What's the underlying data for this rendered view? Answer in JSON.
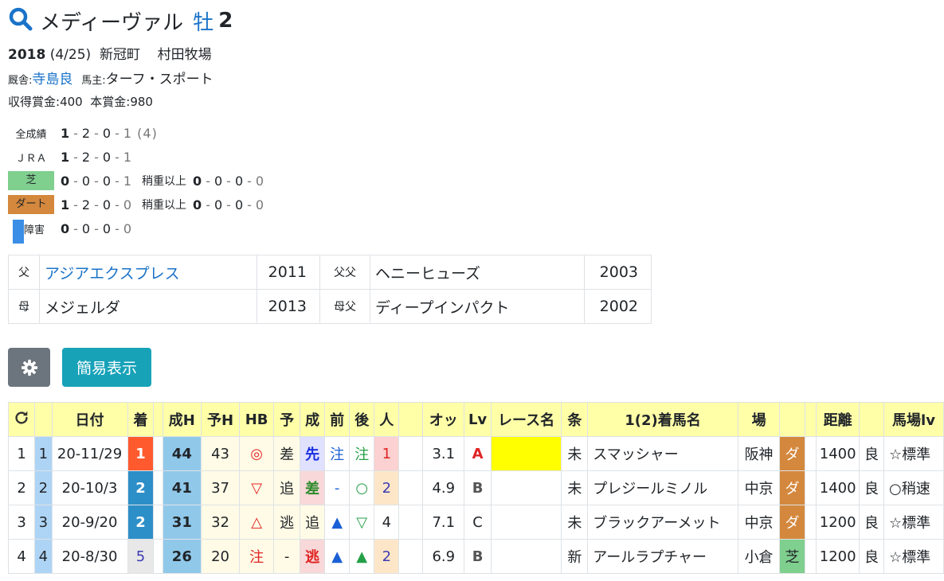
{
  "header": {
    "horse_name": "メディーヴァル",
    "sex": "牡",
    "age": "2"
  },
  "info": {
    "birth_year": "2018",
    "birth_date": "(4/25)",
    "region": "新冠町",
    "farm": "村田牧場",
    "trainer_label": "厩舎:",
    "trainer": "寺島良",
    "owner_label": "馬主:",
    "owner": "ターフ・スポート",
    "prize_label1": "収得賞金:",
    "prize1": "400",
    "prize_label2": "本賞金:",
    "prize2": "980"
  },
  "records": [
    {
      "label": "全成績",
      "w": "1",
      "r": [
        "2",
        "0",
        "1"
      ],
      "extra": "(4)"
    },
    {
      "label": "ＪＲＡ",
      "w": "1",
      "r": [
        "2",
        "0",
        "1"
      ]
    },
    {
      "label": "芝",
      "w": "0",
      "r": [
        "0",
        "0",
        "1"
      ],
      "heavy_label": "稍重以上",
      "hw": "0",
      "hr": [
        "0",
        "0",
        "0"
      ]
    },
    {
      "label": "ダート",
      "w": "1",
      "r": [
        "2",
        "0",
        "0"
      ],
      "heavy_label": "稍重以上",
      "hw": "0",
      "hr": [
        "0",
        "0",
        "0"
      ]
    },
    {
      "label": "障害",
      "w": "0",
      "r": [
        "0",
        "0",
        "0"
      ]
    }
  ],
  "pedigree": {
    "sire_label": "父",
    "sire": "アジアエクスプレス",
    "sire_year": "2011",
    "sire_sire_label": "父父",
    "sire_sire": "ヘニーヒューズ",
    "sire_sire_year": "2003",
    "dam_label": "母",
    "dam": "メジェルダ",
    "dam_year": "2013",
    "dam_sire_label": "母父",
    "dam_sire": "ディープインパクト",
    "dam_sire_year": "2002"
  },
  "buttons": {
    "simple": "簡易表示"
  },
  "results": {
    "headers": [
      "日付",
      "着",
      "成H",
      "予H",
      "HB",
      "予",
      "成",
      "前",
      "後",
      "人",
      "オッ",
      "Lv",
      "レース名",
      "条",
      "1(2)着馬名",
      "場",
      "距離",
      "馬場lv"
    ],
    "rows": [
      {
        "no": "1",
        "idx": "1",
        "date": "20-11/29",
        "finish": "1",
        "sh": "44",
        "yh": "43",
        "hb": "◎",
        "pred": "差",
        "style": "先",
        "front": "注",
        "back": "注",
        "pop": "1",
        "odds": "3.1",
        "lv": "A",
        "race": "",
        "cond": "未",
        "winner": "スマッシャー",
        "course": "阪神",
        "surface": "ダ",
        "dist": "1400",
        "going": "良",
        "glv": "☆標準"
      },
      {
        "no": "2",
        "idx": "2",
        "date": "20-10/3",
        "finish": "2",
        "sh": "41",
        "yh": "37",
        "hb": "▽",
        "pred": "追",
        "style": "差",
        "front": "-",
        "back": "○",
        "pop": "2",
        "odds": "4.9",
        "lv": "B",
        "race": "",
        "cond": "未",
        "winner": "プレジールミノル",
        "course": "中京",
        "surface": "ダ",
        "dist": "1400",
        "going": "良",
        "glv": "○稍速"
      },
      {
        "no": "3",
        "idx": "3",
        "date": "20-9/20",
        "finish": "2",
        "sh": "31",
        "yh": "32",
        "hb": "△",
        "pred": "逃",
        "style": "追",
        "front": "▲",
        "back": "▽",
        "pop": "4",
        "odds": "7.1",
        "lv": "C",
        "race": "",
        "cond": "未",
        "winner": "ブラックアーメット",
        "course": "中京",
        "surface": "ダ",
        "dist": "1200",
        "going": "良",
        "glv": "☆標準"
      },
      {
        "no": "4",
        "idx": "4",
        "date": "20-8/30",
        "finish": "5",
        "sh": "26",
        "yh": "20",
        "hb": "注",
        "pred": "-",
        "style": "逃",
        "front": "▲",
        "back": "▲",
        "pop": "2",
        "odds": "6.9",
        "lv": "B",
        "race": "",
        "cond": "新",
        "winner": "アールラプチャー",
        "course": "小倉",
        "surface": "芝",
        "dist": "1200",
        "going": "良",
        "glv": "☆標準"
      }
    ]
  },
  "colors": {
    "link": "#1a73c9",
    "shiba": "#7fcf8f",
    "dirt": "#d4883d",
    "header_bg": "#ffffa8",
    "gear_button": "#6c757d",
    "simple_button": "#17a2b8"
  }
}
